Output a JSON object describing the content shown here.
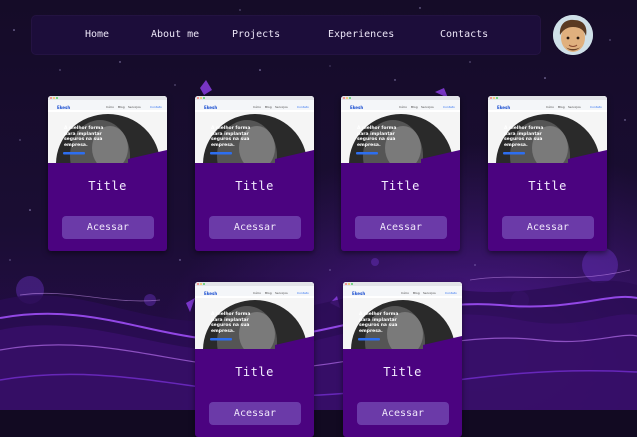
{
  "nav": {
    "items": [
      {
        "label": "Home"
      },
      {
        "label": "About me"
      },
      {
        "label": "Projects"
      },
      {
        "label": "Experiences"
      },
      {
        "label": "Contacts"
      }
    ]
  },
  "avatar": {
    "alt": "profile avatar"
  },
  "preview": {
    "logo": "Ekesh",
    "links": [
      "Início",
      "Blog",
      "Serviços",
      "Contato"
    ],
    "headline": "A melhor forma para implantar seguros na sua empresa."
  },
  "cards": [
    {
      "title": "Title",
      "button": "Acessar"
    },
    {
      "title": "Title",
      "button": "Acessar"
    },
    {
      "title": "Title",
      "button": "Acessar"
    },
    {
      "title": "Title",
      "button": "Acessar"
    },
    {
      "title": "Title",
      "button": "Acessar"
    },
    {
      "title": "Title",
      "button": "Acessar"
    }
  ],
  "colors": {
    "background": "#120a22",
    "nav_bg": "#1c0d3a",
    "card_bg": "#4b0380",
    "button_bg": "#6b3aa8",
    "accent": "#9b4dff"
  }
}
